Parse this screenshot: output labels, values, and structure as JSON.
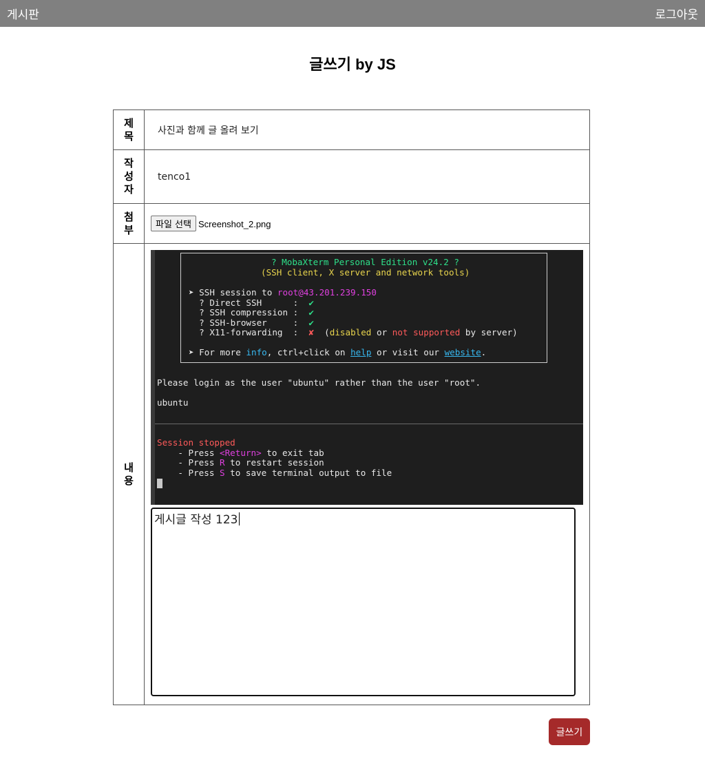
{
  "header": {
    "brand": "게시판",
    "logout_label": "로그아웃"
  },
  "page": {
    "title": "글쓰기 by JS"
  },
  "form": {
    "title_label": [
      "제",
      "목"
    ],
    "title_value": "사진과 함께 글 올려 보기",
    "author_label": [
      "작",
      "성",
      "자"
    ],
    "author_value": "tenco1",
    "attach_label": [
      "첨",
      "부"
    ],
    "file_button": "파일 선택",
    "file_name": "Screenshot_2.png",
    "content_label": [
      "내",
      "용"
    ],
    "content_text": "게시글 작성 123",
    "submit_label": "글쓰기"
  },
  "terminal": {
    "banner_title": "? MobaXterm Personal Edition v24.2 ?",
    "banner_subtitle": "(SSH client, X server and network tools)",
    "session_prefix": "➤ SSH session to ",
    "session_host": "root@43.201.239.150",
    "items": [
      {
        "label": "  ? Direct SSH      :  ",
        "status": "✔",
        "state": "ok"
      },
      {
        "label": "  ? SSH compression :  ",
        "status": "✔",
        "state": "ok"
      },
      {
        "label": "  ? SSH-browser     :  ",
        "status": "✔",
        "state": "ok"
      },
      {
        "label": "  ? X11-forwarding  :  ",
        "status": "✘",
        "state": "fail"
      }
    ],
    "x11_note_open": "  (",
    "x11_disabled": "disabled",
    "x11_or": " or ",
    "x11_not_supported": "not supported",
    "x11_note_close": " by server)",
    "more_prefix": "➤ For more ",
    "more_info": "info",
    "more_mid": ", ctrl+click on ",
    "more_help": "help",
    "more_mid2": " or visit our ",
    "more_website": "website",
    "more_end": ".",
    "login_msg": "Please login as the user \"ubuntu\" rather than the user \"root\".",
    "user": "ubuntu",
    "session_stopped": "Session stopped",
    "press1_a": "    - Press ",
    "press1_key": "<Return>",
    "press1_b": " to exit tab",
    "press2_a": "    - Press ",
    "press2_key": "R",
    "press2_b": " to restart session",
    "press3_a": "    - Press ",
    "press3_key": "S",
    "press3_b": " to save terminal output to file"
  }
}
